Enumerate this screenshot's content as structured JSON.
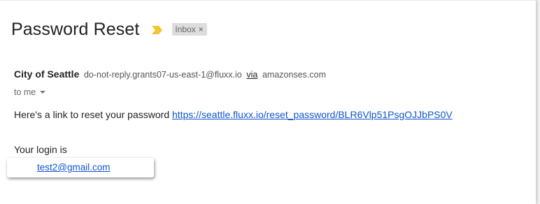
{
  "email": {
    "subject": "Password Reset",
    "label": "Inbox",
    "label_close": "×",
    "sender": {
      "name": "City of Seattle",
      "address": "do-not-reply.grants07-us-east-1@fluxx.io",
      "via_label": "via",
      "via_domain": "amazonses.com"
    },
    "recipient": "to me",
    "body": {
      "reset_text": "Here's a link to reset your password ",
      "reset_link": "https://seattle.fluxx.io/reset_password/BLR6Vlp51PsgOJJbPS0V",
      "login_text": "Your login is",
      "login_email": "test2@gmail.com"
    }
  },
  "colors": {
    "importance_marker": "#f4c430",
    "link": "#1155cc",
    "label_chip": "#dddddd"
  },
  "icons": {
    "importance": "importance-marker-icon",
    "recipient_details": "chevron-down-icon"
  }
}
